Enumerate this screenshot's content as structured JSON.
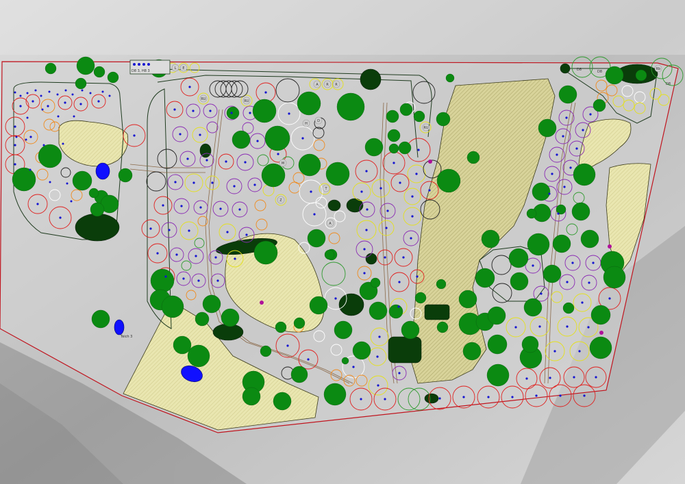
{
  "map": {
    "labels": {
      "top_group": "D8 3, H8 3",
      "pond": "Teich 3",
      "top_right_a": "D8",
      "top_right_b": "D8",
      "top_right_c": "D8"
    },
    "marker_letters": [
      "A",
      "R",
      "R",
      "RU",
      "RU",
      "RU",
      "H",
      "D",
      "M",
      "T",
      "A",
      "L",
      "E",
      "Z",
      "Rb"
    ],
    "colors": {
      "boundary": "#c0141e",
      "meadow": "#e6e2a6",
      "tree": "#0b8a12",
      "dark_shrub": "#0a3d0a",
      "water": "#1010ff",
      "ring_red": "#e0201e",
      "ring_purple": "#8a2bb4",
      "ring_yellow": "#e4e01c",
      "ring_orange": "#f08a1c",
      "ring_white": "#ffffff",
      "ring_black": "#222222",
      "dot": "#1414d0",
      "magenta": "#b0109a"
    }
  }
}
